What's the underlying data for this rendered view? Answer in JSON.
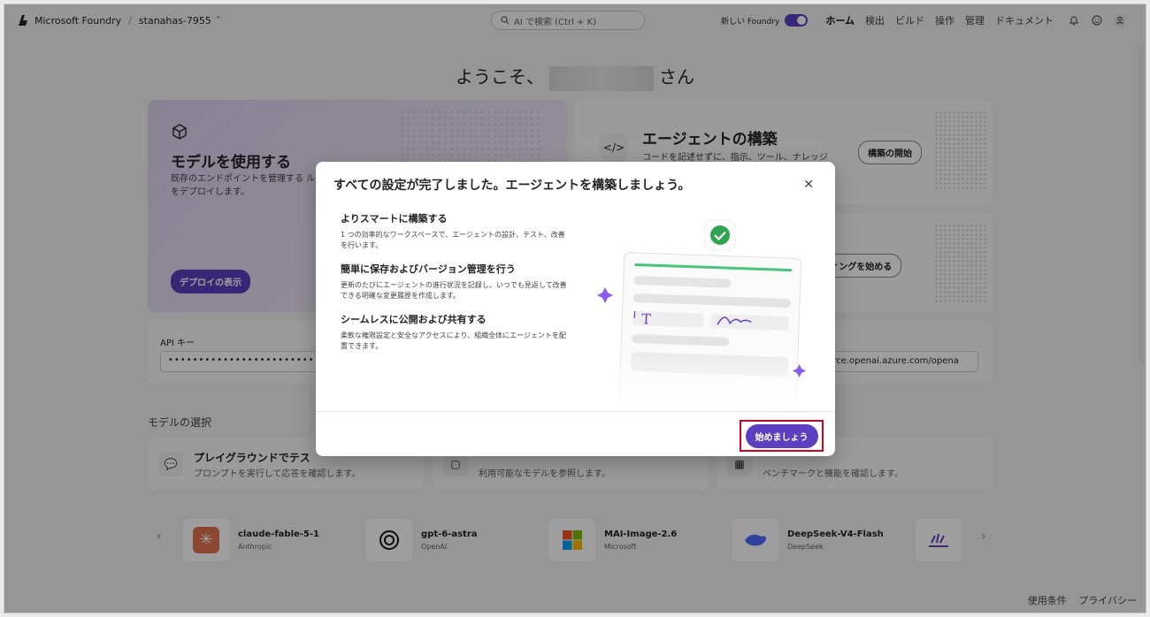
{
  "topbar": {
    "brand": "Microsoft Foundry",
    "separator": "/",
    "project": "stanahas-7955",
    "search_placeholder": "AI で検索 (Ctrl + K)",
    "toggle_label": "新しい Foundry",
    "nav": [
      "ホーム",
      "検出",
      "ビルド",
      "操作",
      "管理",
      "ドキュメント"
    ]
  },
  "welcome": {
    "prefix": "ようこそ、",
    "suffix": "さん"
  },
  "cards": {
    "model": {
      "title": "モデルを使用する",
      "desc": "既存のエンドポイントを管理する ルをデプロイします。",
      "button": "デプロイの表示"
    },
    "agent": {
      "title": "エージェントの構築",
      "desc": "コードを記述せずに、指示、ツール、ナレッジ",
      "button": "構築の開始"
    },
    "code": {
      "button": "ーディングを始める"
    },
    "api": {
      "label": "API キー",
      "value": "••••••••••••••••••••••••••••••••••••••••••••••••••"
    },
    "endpoint": {
      "value": "urce.openai.azure.com/opena"
    }
  },
  "model_selection": {
    "title": "モデルの選択",
    "items": [
      {
        "title": "プレイグラウンドでテス",
        "desc": "プロンプトを実行して応答を確認します。"
      },
      {
        "title": "",
        "desc": "利用可能なモデルを参照します。"
      },
      {
        "title": "",
        "desc": "ベンチマークと機能を確認します。"
      }
    ]
  },
  "models": [
    {
      "name": "claude-fable-5-1",
      "vendor": "Anthropic",
      "logo_color": "#e0734c"
    },
    {
      "name": "gpt-6-astra",
      "vendor": "OpenAI",
      "logo_color": "#111111"
    },
    {
      "name": "MAI-Image-2.6",
      "vendor": "Microsoft",
      "logo_color": "#f25022"
    },
    {
      "name": "DeepSeek-V4-Flash",
      "vendor": "DeepSeek",
      "logo_color": "#4d6bfe"
    }
  ],
  "footer": {
    "terms": "使用条件",
    "privacy": "プライバシー"
  },
  "dialog": {
    "title": "すべての設定が完了しました。エージェントを構築しましょう。",
    "features": [
      {
        "title": "よりスマートに構築する",
        "desc": "1 つの効率的なワークスペースで、エージェントの設計、テスト、改善を行います。"
      },
      {
        "title": "簡単に保存およびバージョン管理を行う",
        "desc": "更新のたびにエージェントの進行状況を記録し、いつでも見返して改善できる明確な変更履歴を作成します。"
      },
      {
        "title": "シームレスに公開および共有する",
        "desc": "柔軟な権限設定と安全なアクセスにより、組織全体にエージェントを配置できます。"
      }
    ],
    "start_button": "始めましょう"
  },
  "colors": {
    "accent": "#5b3fc0",
    "highlight": "#d6001c",
    "success": "#2ea44f"
  }
}
